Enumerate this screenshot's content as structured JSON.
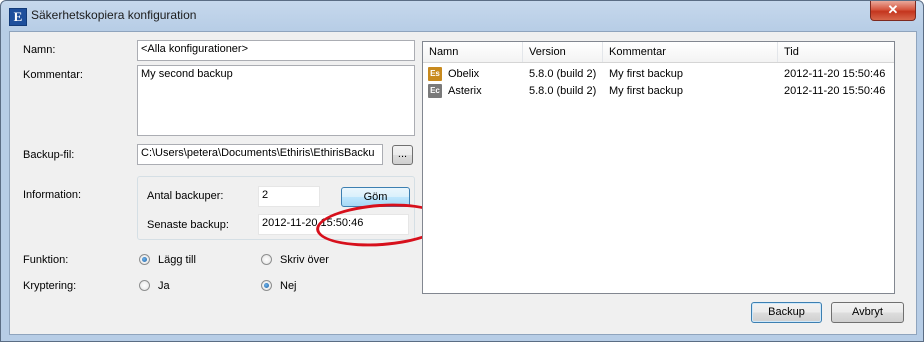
{
  "window": {
    "title": "Säkerhetskopiera konfiguration",
    "app_icon_letter": "E",
    "close_glyph": "✕"
  },
  "form": {
    "name_label": "Namn:",
    "name_value": "<Alla konfigurationer>",
    "comment_label": "Kommentar:",
    "comment_value": "My second backup",
    "backup_file_label": "Backup-fil:",
    "backup_file_value": "C:\\Users\\petera\\Documents\\Ethiris\\EthirisBacku",
    "browse_label": "...",
    "information_label": "Information:",
    "count_label": "Antal backuper:",
    "count_value": "2",
    "hide_button": "Göm",
    "latest_label": "Senaste backup:",
    "latest_value": "2012-11-20 15:50:46",
    "function_label": "Funktion:",
    "function_options": [
      "Lägg till",
      "Skriv över"
    ],
    "function_selected": "Lägg till",
    "encryption_label": "Kryptering:",
    "encryption_options": [
      "Ja",
      "Nej"
    ],
    "encryption_selected": "Nej"
  },
  "list": {
    "columns": [
      "Namn",
      "Version",
      "Kommentar",
      "Tid"
    ],
    "rows": [
      {
        "icon": "Es",
        "icon_color": "#c88a1e",
        "name": "Obelix",
        "version": "5.8.0 (build 2)",
        "comment": "My first backup",
        "time": "2012-11-20 15:50:46"
      },
      {
        "icon": "Ec",
        "icon_color": "#7a7a7a",
        "name": "Asterix",
        "version": "5.8.0 (build 2)",
        "comment": "My first backup",
        "time": "2012-11-20 15:50:46"
      }
    ]
  },
  "footer": {
    "backup_button": "Backup",
    "cancel_button": "Avbryt"
  },
  "colors": {
    "annotation": "#d7101c",
    "titlebar": "#b7cde6",
    "close_button": "#c4351e"
  }
}
